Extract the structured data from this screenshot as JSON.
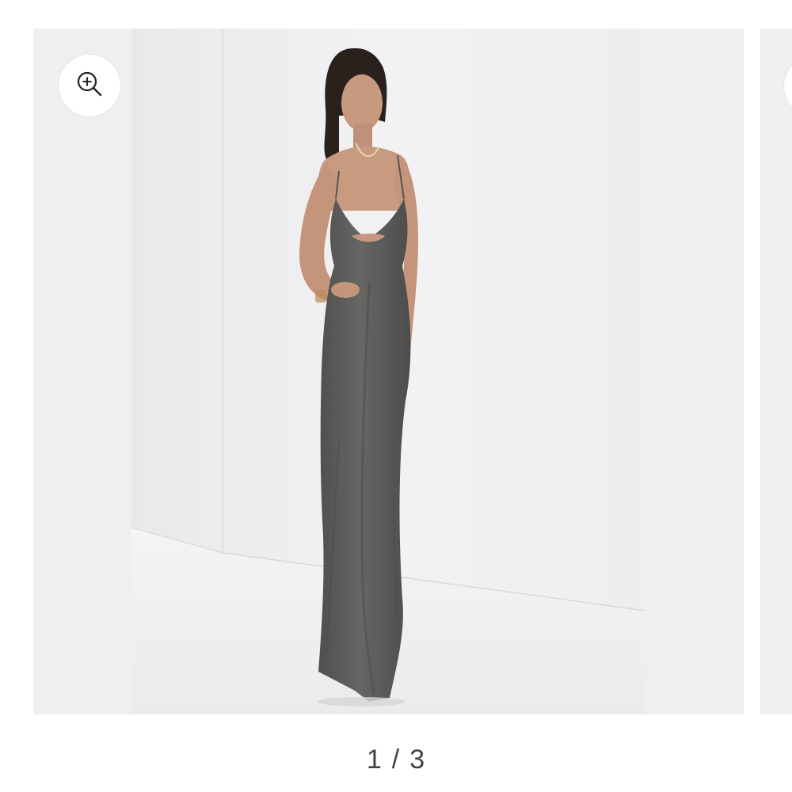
{
  "gallery": {
    "current": "1",
    "separator": "/",
    "total": "3",
    "background_color": "#efeef0",
    "dress_color": "#5d5e5b"
  },
  "icons": {
    "zoom": "zoom-in-icon"
  }
}
